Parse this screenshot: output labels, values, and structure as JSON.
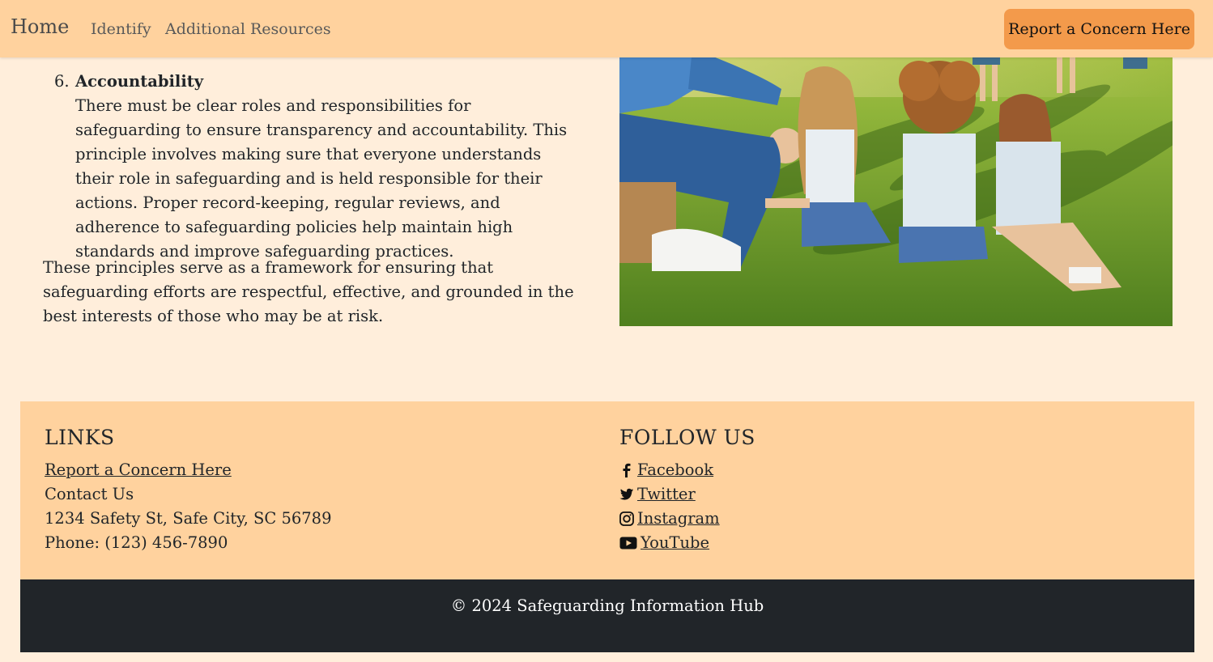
{
  "navbar": {
    "brand": "Home",
    "links": [
      "Identify",
      "Additional Resources"
    ],
    "report_button": "Report a Concern Here"
  },
  "principle": {
    "number": "6.",
    "title": "Accountability",
    "text": "There must be clear roles and responsibilities for safeguarding to ensure transparency and accountability. This principle involves making sure that everyone understands their role in safeguarding and is held responsible for their actions. Proper record-keeping, regular reviews, and adherence to safeguarding policies help maintain high standards and improve safeguarding practices."
  },
  "summary": "These principles serve as a framework for ensuring that safeguarding efforts are respectful, effective, and grounded in the best interests of those who may be at risk.",
  "footer": {
    "links_heading": "LINKS",
    "report_link": "Report a Concern Here",
    "contact_label": "Contact Us",
    "address": "1234 Safety St, Safe City, SC 56789",
    "phone": "Phone: (123) 456-7890",
    "follow_heading": "FOLLOW US",
    "social": [
      {
        "label": "Facebook",
        "icon": "facebook-icon"
      },
      {
        "label": "Twitter",
        "icon": "twitter-icon"
      },
      {
        "label": "Instagram",
        "icon": "instagram-icon"
      },
      {
        "label": "YouTube",
        "icon": "youtube-icon"
      }
    ]
  },
  "copyright": "© 2024 Safeguarding Information Hub",
  "colors": {
    "navbar": "#ffd29e",
    "page_bg": "#ffeedb",
    "report_button": "#f39a4b",
    "footer_bg": "#ffd29e",
    "copyright_bg": "#212529"
  }
}
